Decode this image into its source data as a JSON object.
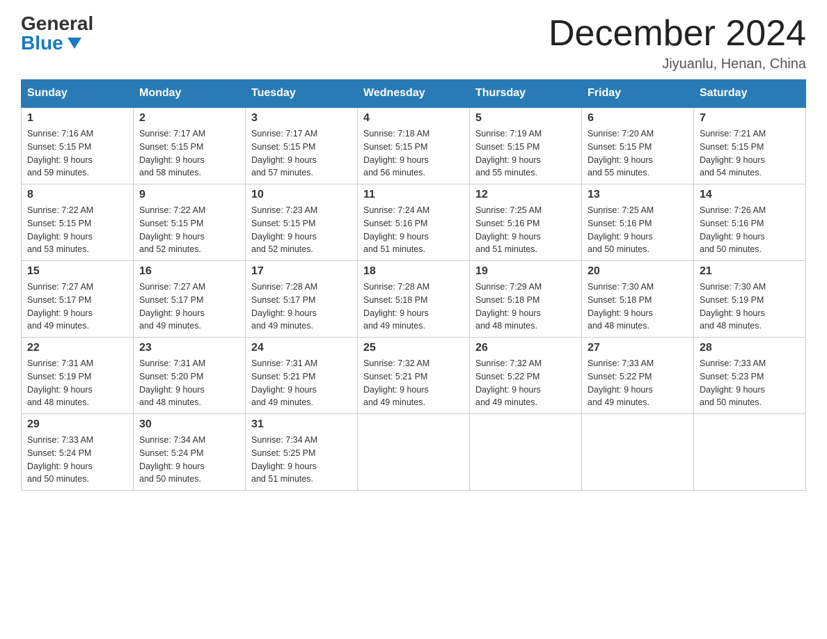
{
  "logo": {
    "general": "General",
    "blue": "Blue"
  },
  "header": {
    "month_year": "December 2024",
    "location": "Jiyuanlu, Henan, China"
  },
  "days_of_week": [
    "Sunday",
    "Monday",
    "Tuesday",
    "Wednesday",
    "Thursday",
    "Friday",
    "Saturday"
  ],
  "weeks": [
    [
      {
        "day": "1",
        "sunrise": "7:16 AM",
        "sunset": "5:15 PM",
        "daylight": "9 hours and 59 minutes."
      },
      {
        "day": "2",
        "sunrise": "7:17 AM",
        "sunset": "5:15 PM",
        "daylight": "9 hours and 58 minutes."
      },
      {
        "day": "3",
        "sunrise": "7:17 AM",
        "sunset": "5:15 PM",
        "daylight": "9 hours and 57 minutes."
      },
      {
        "day": "4",
        "sunrise": "7:18 AM",
        "sunset": "5:15 PM",
        "daylight": "9 hours and 56 minutes."
      },
      {
        "day": "5",
        "sunrise": "7:19 AM",
        "sunset": "5:15 PM",
        "daylight": "9 hours and 55 minutes."
      },
      {
        "day": "6",
        "sunrise": "7:20 AM",
        "sunset": "5:15 PM",
        "daylight": "9 hours and 55 minutes."
      },
      {
        "day": "7",
        "sunrise": "7:21 AM",
        "sunset": "5:15 PM",
        "daylight": "9 hours and 54 minutes."
      }
    ],
    [
      {
        "day": "8",
        "sunrise": "7:22 AM",
        "sunset": "5:15 PM",
        "daylight": "9 hours and 53 minutes."
      },
      {
        "day": "9",
        "sunrise": "7:22 AM",
        "sunset": "5:15 PM",
        "daylight": "9 hours and 52 minutes."
      },
      {
        "day": "10",
        "sunrise": "7:23 AM",
        "sunset": "5:15 PM",
        "daylight": "9 hours and 52 minutes."
      },
      {
        "day": "11",
        "sunrise": "7:24 AM",
        "sunset": "5:16 PM",
        "daylight": "9 hours and 51 minutes."
      },
      {
        "day": "12",
        "sunrise": "7:25 AM",
        "sunset": "5:16 PM",
        "daylight": "9 hours and 51 minutes."
      },
      {
        "day": "13",
        "sunrise": "7:25 AM",
        "sunset": "5:16 PM",
        "daylight": "9 hours and 50 minutes."
      },
      {
        "day": "14",
        "sunrise": "7:26 AM",
        "sunset": "5:16 PM",
        "daylight": "9 hours and 50 minutes."
      }
    ],
    [
      {
        "day": "15",
        "sunrise": "7:27 AM",
        "sunset": "5:17 PM",
        "daylight": "9 hours and 49 minutes."
      },
      {
        "day": "16",
        "sunrise": "7:27 AM",
        "sunset": "5:17 PM",
        "daylight": "9 hours and 49 minutes."
      },
      {
        "day": "17",
        "sunrise": "7:28 AM",
        "sunset": "5:17 PM",
        "daylight": "9 hours and 49 minutes."
      },
      {
        "day": "18",
        "sunrise": "7:28 AM",
        "sunset": "5:18 PM",
        "daylight": "9 hours and 49 minutes."
      },
      {
        "day": "19",
        "sunrise": "7:29 AM",
        "sunset": "5:18 PM",
        "daylight": "9 hours and 48 minutes."
      },
      {
        "day": "20",
        "sunrise": "7:30 AM",
        "sunset": "5:18 PM",
        "daylight": "9 hours and 48 minutes."
      },
      {
        "day": "21",
        "sunrise": "7:30 AM",
        "sunset": "5:19 PM",
        "daylight": "9 hours and 48 minutes."
      }
    ],
    [
      {
        "day": "22",
        "sunrise": "7:31 AM",
        "sunset": "5:19 PM",
        "daylight": "9 hours and 48 minutes."
      },
      {
        "day": "23",
        "sunrise": "7:31 AM",
        "sunset": "5:20 PM",
        "daylight": "9 hours and 48 minutes."
      },
      {
        "day": "24",
        "sunrise": "7:31 AM",
        "sunset": "5:21 PM",
        "daylight": "9 hours and 49 minutes."
      },
      {
        "day": "25",
        "sunrise": "7:32 AM",
        "sunset": "5:21 PM",
        "daylight": "9 hours and 49 minutes."
      },
      {
        "day": "26",
        "sunrise": "7:32 AM",
        "sunset": "5:22 PM",
        "daylight": "9 hours and 49 minutes."
      },
      {
        "day": "27",
        "sunrise": "7:33 AM",
        "sunset": "5:22 PM",
        "daylight": "9 hours and 49 minutes."
      },
      {
        "day": "28",
        "sunrise": "7:33 AM",
        "sunset": "5:23 PM",
        "daylight": "9 hours and 50 minutes."
      }
    ],
    [
      {
        "day": "29",
        "sunrise": "7:33 AM",
        "sunset": "5:24 PM",
        "daylight": "9 hours and 50 minutes."
      },
      {
        "day": "30",
        "sunrise": "7:34 AM",
        "sunset": "5:24 PM",
        "daylight": "9 hours and 50 minutes."
      },
      {
        "day": "31",
        "sunrise": "7:34 AM",
        "sunset": "5:25 PM",
        "daylight": "9 hours and 51 minutes."
      },
      null,
      null,
      null,
      null
    ]
  ],
  "labels": {
    "sunrise": "Sunrise:",
    "sunset": "Sunset:",
    "daylight": "Daylight:"
  }
}
